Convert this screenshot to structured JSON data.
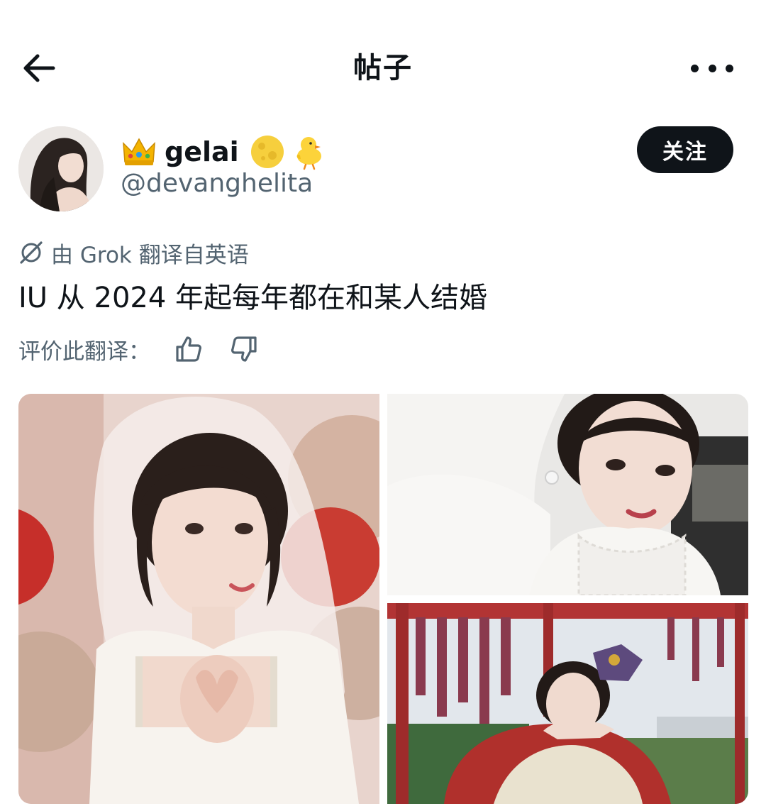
{
  "header": {
    "title": "帖子"
  },
  "author": {
    "display_name": "gelai",
    "handle": "@devanghelita",
    "follow_label": "关注",
    "badges": [
      "crown-emoji",
      "full-moon-emoji",
      "chick-emoji"
    ]
  },
  "translation": {
    "note": "由 Grok 翻译自英语",
    "text": "IU 从 2024 年起每年都在和某人结婚",
    "rate_label": "评价此翻译："
  },
  "media": {
    "photos": [
      "bride-veil-heart-hands-photo",
      "bride-veil-selfie-photo",
      "hanbok-royal-costume-photo"
    ]
  },
  "colors": {
    "text_primary": "#0f1419",
    "text_secondary": "#536471",
    "button_bg": "#0f1419"
  }
}
